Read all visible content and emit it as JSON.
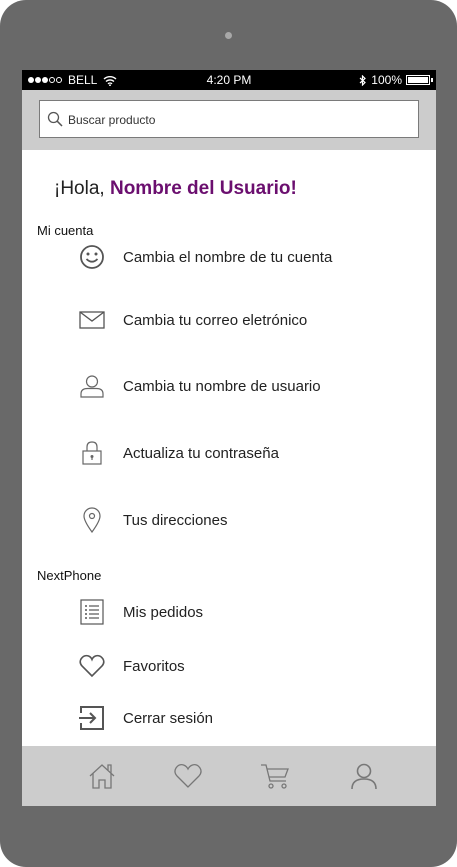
{
  "status_bar": {
    "carrier": "BELL",
    "time": "4:20 PM",
    "battery": "100%",
    "signal_bars_filled": 3,
    "signal_bars_total": 5
  },
  "search": {
    "placeholder": "Buscar producto"
  },
  "greeting": {
    "prefix": "¡Hola,",
    "user_name": "Nombre del Usuario!"
  },
  "accent_color": "#6b0f6f",
  "sections": [
    {
      "title": "Mi cuenta",
      "items": [
        {
          "icon": "smiley-icon",
          "label": "Cambia el nombre de tu cuenta"
        },
        {
          "icon": "envelope-icon",
          "label": "Cambia tu correo eletrónico"
        },
        {
          "icon": "user-icon",
          "label": "Cambia tu nombre de usuario"
        },
        {
          "icon": "lock-icon",
          "label": "Actualiza tu contraseña"
        },
        {
          "icon": "location-pin-icon",
          "label": "Tus direcciones"
        }
      ]
    },
    {
      "title": "NextPhone",
      "items": [
        {
          "icon": "list-icon",
          "label": "Mis pedidos"
        },
        {
          "icon": "heart-icon",
          "label": "Favoritos"
        },
        {
          "icon": "logout-icon",
          "label": "Cerrar sesión"
        }
      ]
    }
  ],
  "tab_bar": [
    "home-icon",
    "heart-icon",
    "cart-icon",
    "profile-icon"
  ]
}
